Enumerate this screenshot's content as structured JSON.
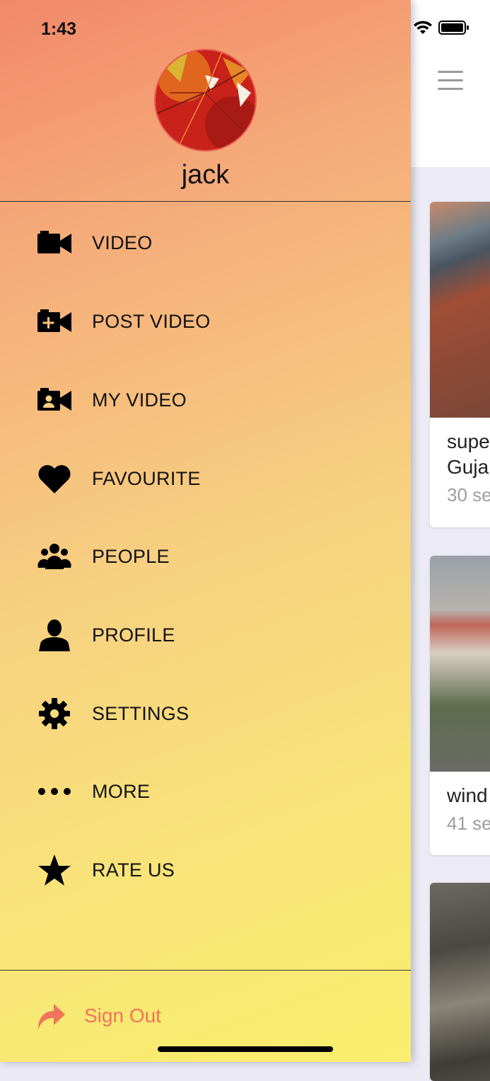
{
  "status_bar": {
    "time": "1:43"
  },
  "drawer": {
    "username": "jack",
    "menu": [
      {
        "label": "VIDEO",
        "icon": "video-camera-icon"
      },
      {
        "label": "POST VIDEO",
        "icon": "video-add-icon"
      },
      {
        "label": "MY VIDEO",
        "icon": "video-user-icon"
      },
      {
        "label": "FAVOURITE",
        "icon": "heart-icon"
      },
      {
        "label": "PEOPLE",
        "icon": "people-icon"
      },
      {
        "label": "PROFILE",
        "icon": "person-icon"
      },
      {
        "label": "SETTINGS",
        "icon": "gear-icon"
      },
      {
        "label": "MORE",
        "icon": "more-dots-icon"
      },
      {
        "label": "RATE US",
        "icon": "star-icon"
      }
    ],
    "sign_out": {
      "label": "Sign Out",
      "icon": "sign-out-arrow-icon"
    }
  },
  "feed": {
    "cards": [
      {
        "title_line1": "supe",
        "title_line2": "Guja",
        "meta": "30 se"
      },
      {
        "title_line1": "wind",
        "meta": "41 se"
      }
    ]
  },
  "colors": {
    "drawer_top": "#f2886a",
    "drawer_bottom": "#f9ee6d",
    "sign_out": "#f0735c",
    "avatar_border": "#e85a4f"
  }
}
